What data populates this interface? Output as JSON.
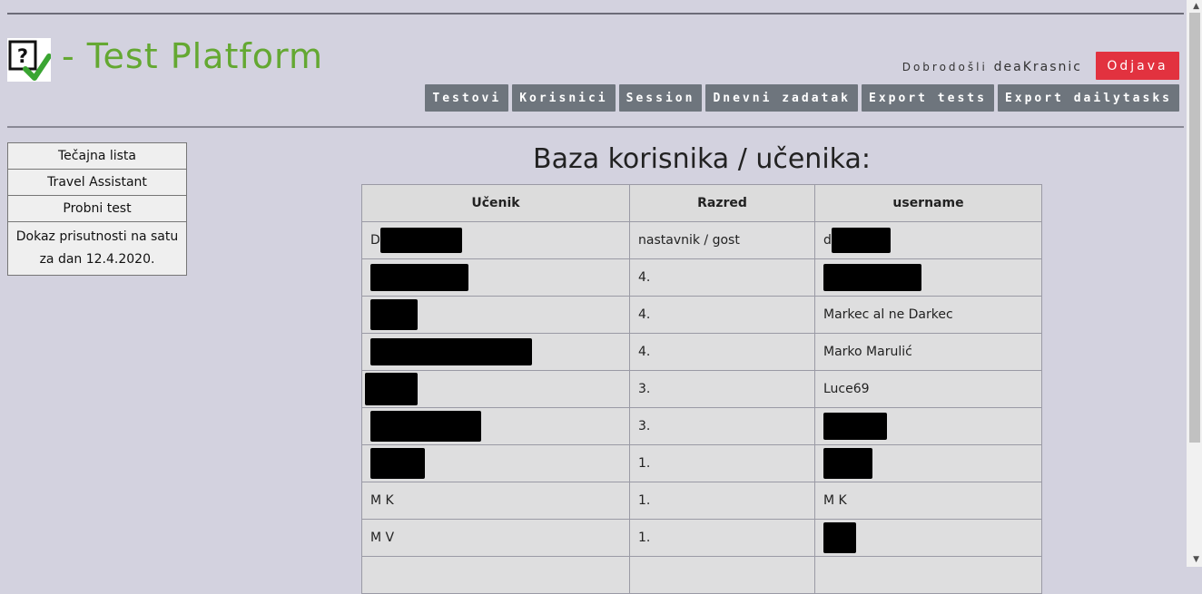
{
  "header": {
    "logo_icon": "question-check-icon",
    "title": "- Test Platform",
    "welcome_label": "Dobrodošli",
    "username": "deaKrasnic",
    "logout_label": "Odjava"
  },
  "nav": [
    "Testovi",
    "Korisnici",
    "Session",
    "Dnevni zadatak",
    "Export tests",
    "Export dailytasks"
  ],
  "sidebar": [
    "Tečajna lista",
    "Travel Assistant",
    "Probni test",
    "Dokaz prisutnosti na satu za dan 12.4.2020."
  ],
  "main": {
    "title": "Baza korisnika / učenika:",
    "columns": [
      "Učenik",
      "Razred",
      "username"
    ],
    "rows": [
      {
        "ucenik": "D",
        "razred": "nastavnik / gost",
        "username": "d"
      },
      {
        "ucenik": "",
        "razred": "4.",
        "username": ""
      },
      {
        "ucenik": "",
        "razred": "4.",
        "username": "Markec al ne Darkec"
      },
      {
        "ucenik": "",
        "razred": "4.",
        "username": "Marko Marulić"
      },
      {
        "ucenik": "",
        "razred": "3.",
        "username": "Luce69"
      },
      {
        "ucenik": "",
        "razred": "3.",
        "username": ""
      },
      {
        "ucenik": "",
        "razred": "1.",
        "username": ""
      },
      {
        "ucenik": "M K",
        "razred": "1.",
        "username": "M K"
      },
      {
        "ucenik": "M V",
        "razred": "1.",
        "username": ""
      }
    ]
  },
  "colors": {
    "background": "#d3d2df",
    "title_green": "#64a832",
    "logout_red": "#e2323f",
    "nav_gray": "#6e757d"
  }
}
